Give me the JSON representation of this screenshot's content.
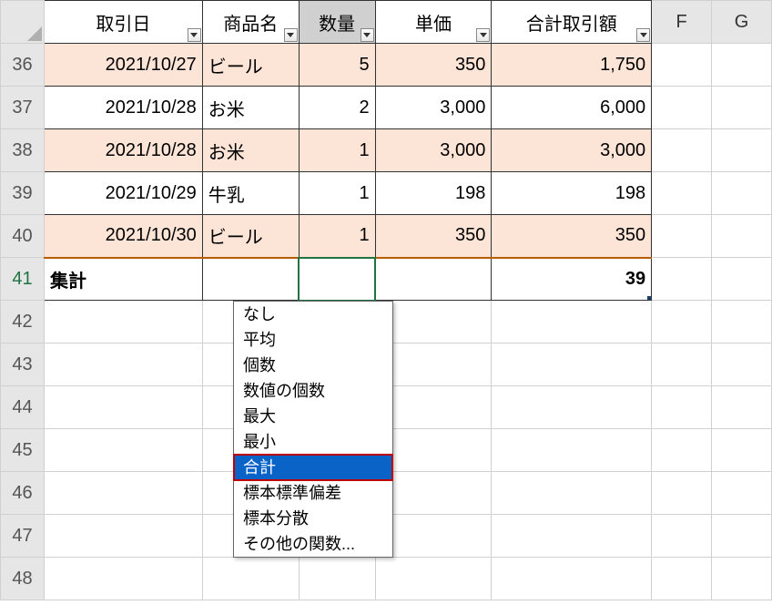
{
  "columns": {
    "A": "取引日",
    "B": "商品名",
    "C": "数量",
    "D": "単価",
    "E": "合計取引額",
    "F": "F",
    "G": "G"
  },
  "row_headers": [
    "36",
    "37",
    "38",
    "39",
    "40",
    "41",
    "42",
    "43",
    "44",
    "45",
    "46",
    "47",
    "48"
  ],
  "rows": [
    {
      "date": "2021/10/27",
      "name": "ビール",
      "qty": "5",
      "price": "350",
      "total": "1,750"
    },
    {
      "date": "2021/10/28",
      "name": "お米",
      "qty": "2",
      "price": "3,000",
      "total": "6,000"
    },
    {
      "date": "2021/10/28",
      "name": "お米",
      "qty": "1",
      "price": "3,000",
      "total": "3,000"
    },
    {
      "date": "2021/10/29",
      "name": "牛乳",
      "qty": "1",
      "price": "198",
      "total": "198"
    },
    {
      "date": "2021/10/30",
      "name": "ビール",
      "qty": "1",
      "price": "350",
      "total": "350"
    }
  ],
  "total_row": {
    "label": "集計",
    "value": "39"
  },
  "dropdown": {
    "items": [
      "なし",
      "平均",
      "個数",
      "数値の個数",
      "最大",
      "最小",
      "合計",
      "標本標準偏差",
      "標本分散",
      "その他の関数..."
    ],
    "selected_index": 6
  }
}
